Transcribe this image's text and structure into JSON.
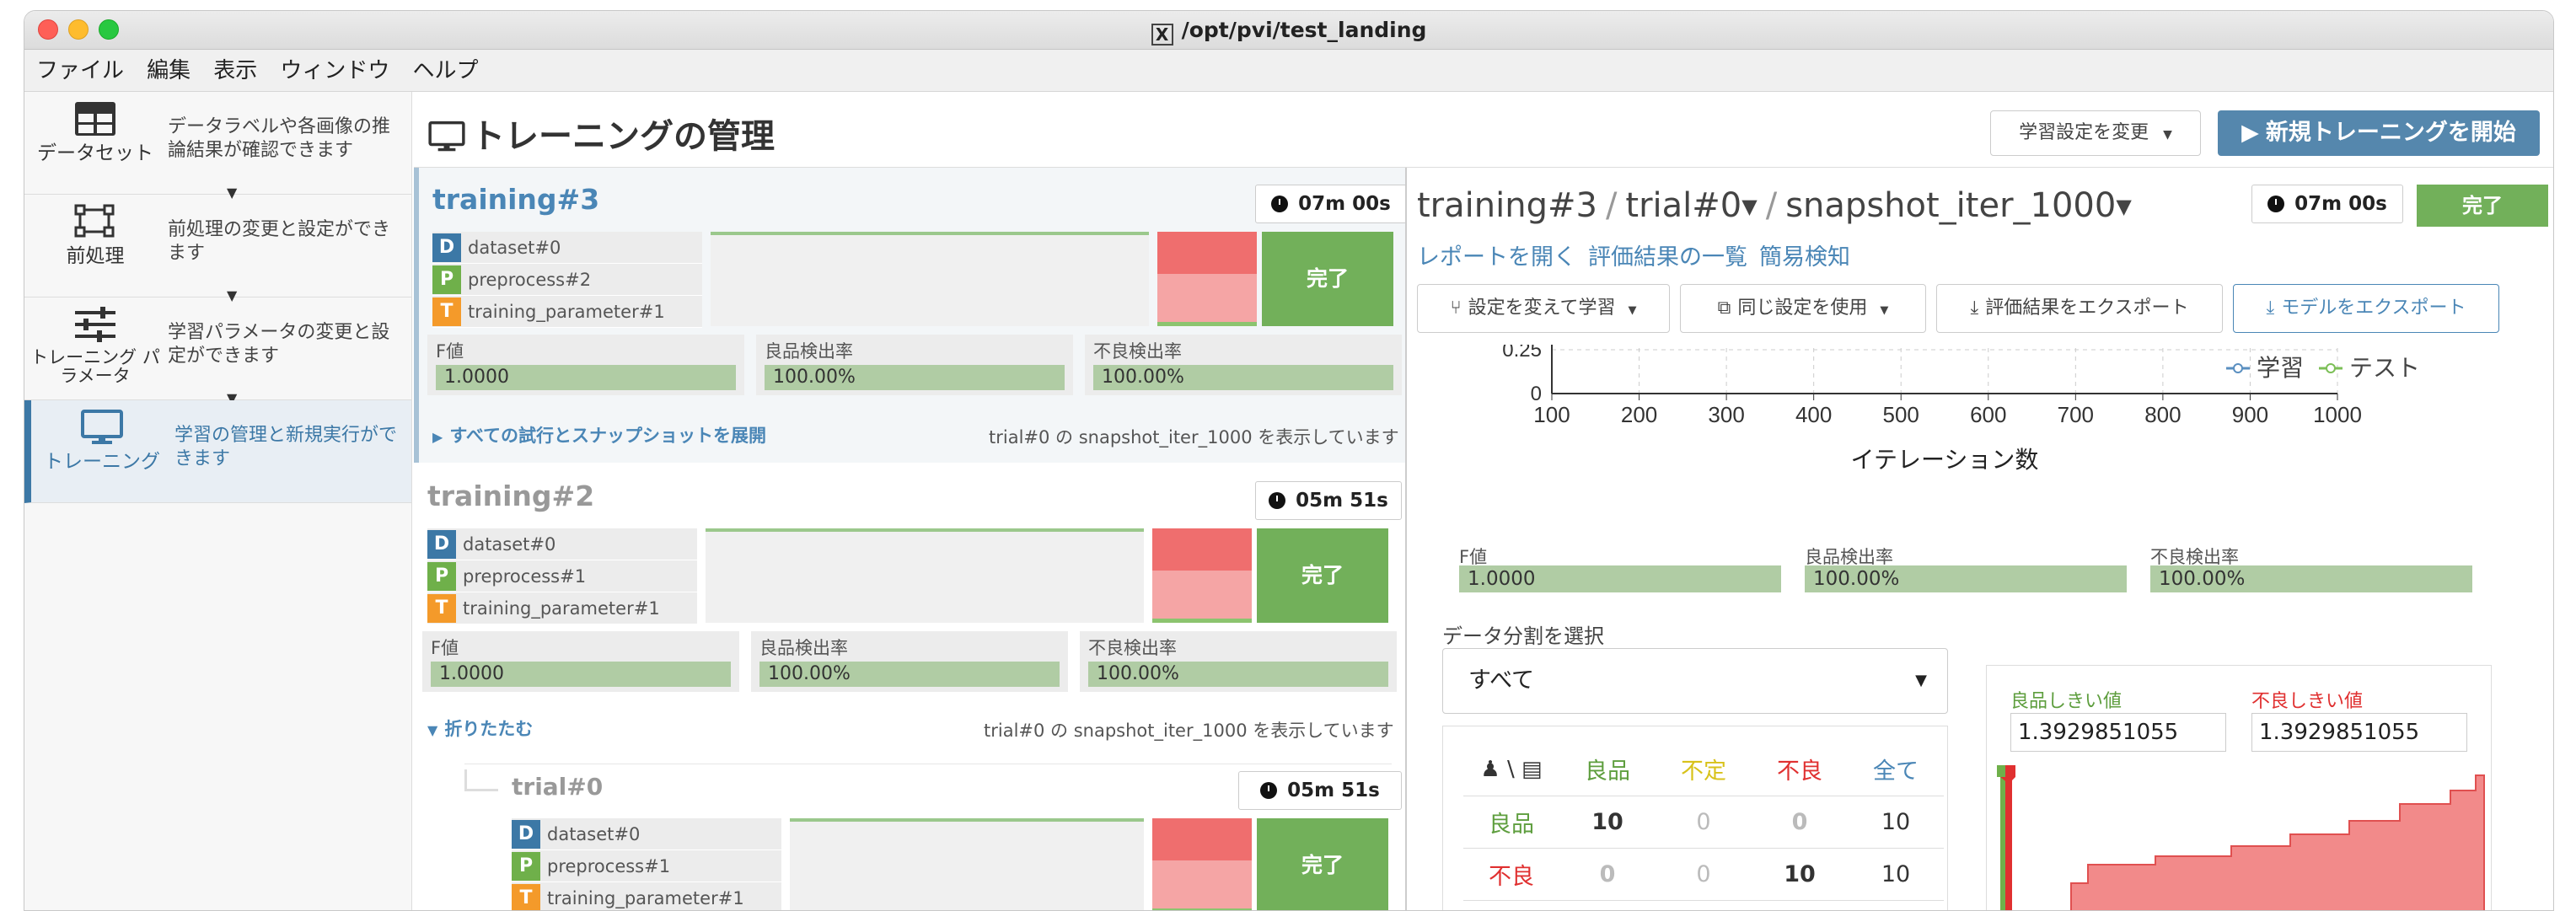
{
  "window": {
    "title": "/opt/pvi/test_landing",
    "x_icon": "X"
  },
  "menu": [
    "ファイル",
    "編集",
    "表示",
    "ウィンドウ",
    "ヘルプ"
  ],
  "sidebar": [
    {
      "label": "データセット",
      "desc": "データラベルや各画像の推論結果が確認できます",
      "icon": "table-icon"
    },
    {
      "label": "前処理",
      "desc": "前処理の変更と設定ができます",
      "icon": "preprocess-icon"
    },
    {
      "label": "トレーニング パラメータ",
      "desc": "学習パラメータの変更と設定ができます",
      "icon": "sliders-icon"
    },
    {
      "label": "トレーニング",
      "desc": "学習の管理と新規実行ができます",
      "icon": "monitor-icon"
    }
  ],
  "header": {
    "title": "トレーニングの管理",
    "change_settings": "学習設定を変更",
    "new_training": "新規トレーニングを開始"
  },
  "trainings": [
    {
      "name": "training#3",
      "time": "07m 00s",
      "tags": [
        {
          "letter": "D",
          "label": "dataset#0"
        },
        {
          "letter": "P",
          "label": "preprocess#2"
        },
        {
          "letter": "T",
          "label": "training_parameter#1"
        }
      ],
      "status": "完了",
      "metrics": [
        {
          "label": "F値",
          "value": "1.0000"
        },
        {
          "label": "良品検出率",
          "value": "100.00%"
        },
        {
          "label": "不良検出率",
          "value": "100.00%"
        }
      ],
      "expand": "すべての試行とスナップショットを展開",
      "note": "trial#0 の snapshot_iter_1000 を表示しています"
    },
    {
      "name": "training#2",
      "time": "05m 51s",
      "tags": [
        {
          "letter": "D",
          "label": "dataset#0"
        },
        {
          "letter": "P",
          "label": "preprocess#1"
        },
        {
          "letter": "T",
          "label": "training_parameter#1"
        }
      ],
      "status": "完了",
      "metrics": [
        {
          "label": "F値",
          "value": "1.0000"
        },
        {
          "label": "良品検出率",
          "value": "100.00%"
        },
        {
          "label": "不良検出率",
          "value": "100.00%"
        }
      ],
      "expand": "折りたたむ",
      "note": "trial#0 の snapshot_iter_1000 を表示しています"
    }
  ],
  "trial": {
    "name": "trial#0",
    "time": "05m 51s",
    "tags": [
      {
        "letter": "D",
        "label": "dataset#0"
      },
      {
        "letter": "P",
        "label": "preprocess#1"
      },
      {
        "letter": "T",
        "label": "training_parameter#1"
      }
    ],
    "status": "完了"
  },
  "detail": {
    "crumb": [
      "training#3",
      "trial#0",
      "snapshot_iter_1000"
    ],
    "time": "07m 00s",
    "status": "完了",
    "links": [
      "レポートを開く",
      "評価結果の一覧",
      "簡易検知"
    ],
    "buttons": [
      "設定を変えて学習",
      "同じ設定を使用",
      "評価結果をエクスポート",
      "モデルをエクスポート"
    ],
    "metrics": [
      {
        "label": "F値",
        "value": "1.0000"
      },
      {
        "label": "良品検出率",
        "value": "100.00%"
      },
      {
        "label": "不良検出率",
        "value": "100.00%"
      }
    ],
    "split_label": "データ分割を選択",
    "split_value": "すべて",
    "table": {
      "corner": "\\",
      "cols": [
        "良品",
        "不定",
        "不良",
        "全て"
      ],
      "rows": [
        {
          "label": "良品",
          "cells": [
            "10",
            "0",
            "0",
            "10"
          ]
        },
        {
          "label": "不良",
          "cells": [
            "0",
            "0",
            "10",
            "10"
          ]
        }
      ]
    },
    "threshold": {
      "good_label": "良品しきい値",
      "good_value": "1.3929851055",
      "bad_label": "不良しきい値",
      "bad_value": "1.3929851055"
    }
  },
  "chart_data": {
    "type": "line",
    "xlabel": "イテレーション数",
    "x_ticks": [
      100,
      200,
      300,
      400,
      500,
      600,
      700,
      800,
      900,
      1000
    ],
    "y_ticks_visible": [
      "0.25",
      "0"
    ],
    "xlim": [
      100,
      1000
    ],
    "series": [
      {
        "name": "学習",
        "color": "#5a8fc0"
      },
      {
        "name": "テスト",
        "color": "#7cbf57"
      }
    ],
    "legend": "top-right",
    "grid": true
  }
}
